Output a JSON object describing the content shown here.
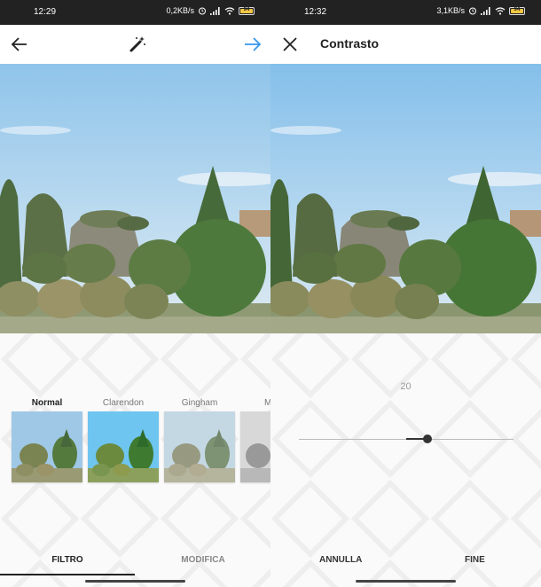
{
  "left": {
    "status": {
      "time": "12:29",
      "speed": "0,2KB/s",
      "battery": "94"
    },
    "filters": [
      {
        "name": "Normal",
        "active": true
      },
      {
        "name": "Clarendon",
        "active": false
      },
      {
        "name": "Gingham",
        "active": false
      },
      {
        "name": "M",
        "active": false
      }
    ],
    "tabs": {
      "filter": "FILTRO",
      "edit": "MODIFICA"
    },
    "icons": {
      "back": "arrow-left-icon",
      "magic": "magic-wand-icon",
      "next": "arrow-right-icon"
    },
    "colors": {
      "next_arrow": "#3897f0"
    }
  },
  "right": {
    "status": {
      "time": "12:32",
      "speed": "3,1KB/s",
      "battery": "94"
    },
    "title": "Contrasto",
    "slider": {
      "value": "20",
      "level": 0.2
    },
    "buttons": {
      "cancel": "ANNULLA",
      "done": "FINE"
    },
    "icons": {
      "close": "close-icon"
    }
  }
}
